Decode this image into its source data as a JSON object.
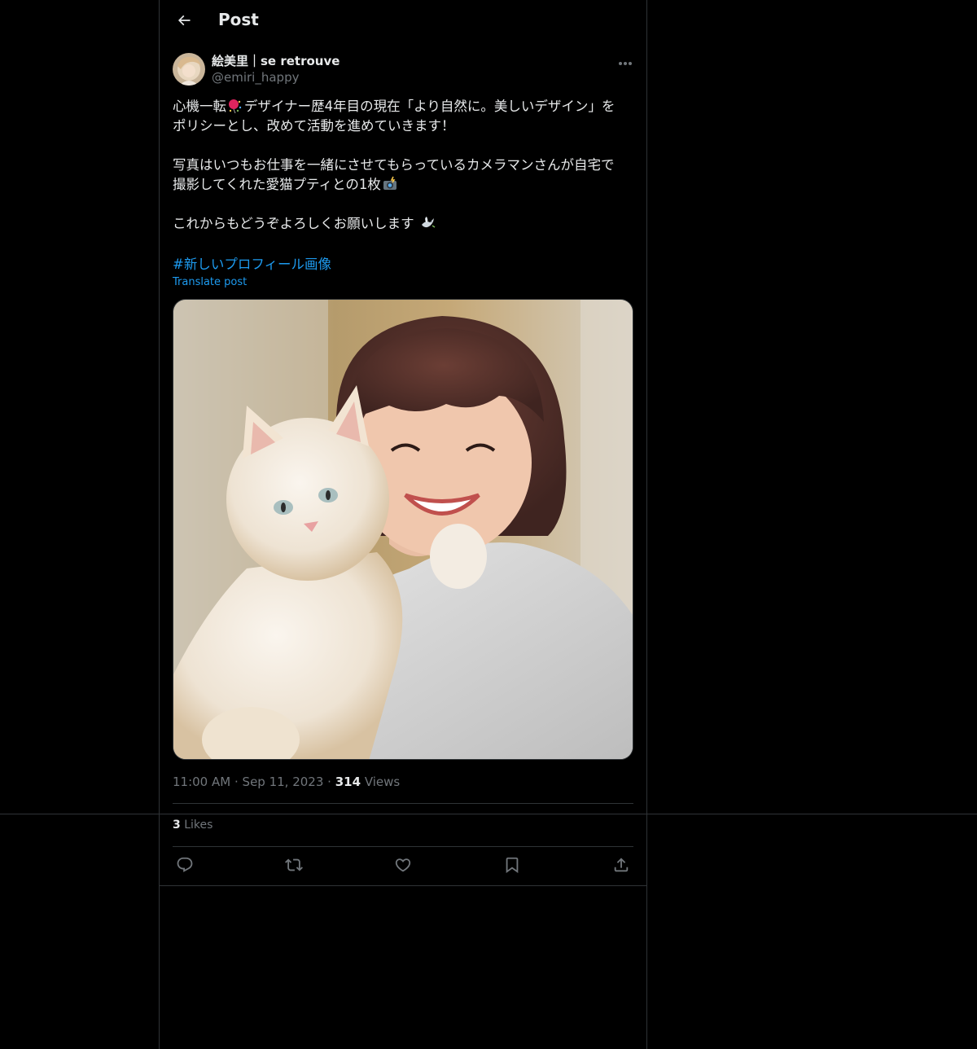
{
  "header": {
    "title": "Post",
    "back_icon": "arrow-left-icon"
  },
  "author": {
    "name": "絵美里｜se retrouve",
    "handle": "@emiri_happy",
    "more_icon": "more-horizontal-icon"
  },
  "post": {
    "line1a": "心機一転",
    "line1b": "デザイナー歴4年目の現在「より自然に。美しいデザイン」を",
    "line2": "ポリシーとし、改めて活動を進めていきます！",
    "line3": "写真はいつもお仕事を一緒にさせてもらっているカメラマンさんが自宅で",
    "line4": "撮影してくれた愛猫プティとの1枚",
    "line5": "これからもどうぞよろしくお願いします",
    "hashtag": "#新しいプロフィール画像",
    "translate": "Translate post",
    "emoji": [
      "balloon-confetti-emoji",
      "camera-flash-emoji",
      "dove-emoji"
    ]
  },
  "meta": {
    "time": "11:00 AM",
    "dot": "·",
    "date": "Sep 11, 2023",
    "views_count": "314",
    "views_label": "Views"
  },
  "likes": {
    "count": "3",
    "label": "Likes"
  },
  "actions": [
    "reply-icon",
    "repost-icon",
    "like-icon",
    "bookmark-icon",
    "share-icon"
  ],
  "colors": {
    "background": "#000000",
    "border": "#2f3336",
    "text": "#e7e9ea",
    "muted": "#71767b",
    "link": "#1d9bf0"
  }
}
